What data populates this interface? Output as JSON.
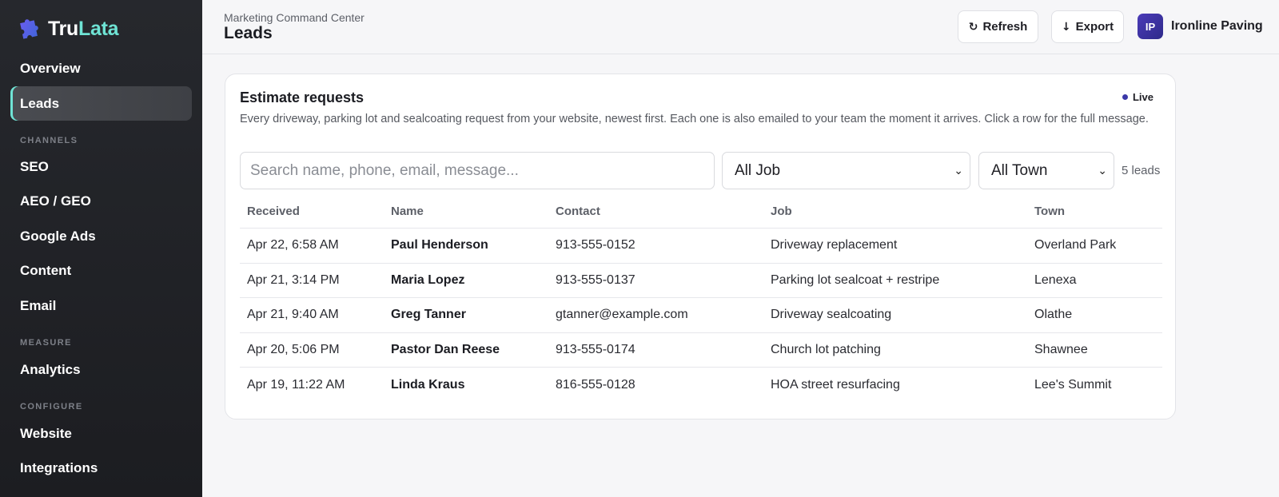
{
  "brand": {
    "part1": "Tru",
    "part2": "Lata",
    "accent_color": "#6fe3d4",
    "logo_icon": "puzzle-logo-icon"
  },
  "sidebar": {
    "items": [
      {
        "label": "Overview"
      },
      {
        "label": "Leads",
        "active": true
      },
      {
        "label": "SEO"
      },
      {
        "label": "AEO / GEO"
      },
      {
        "label": "Google Ads"
      },
      {
        "label": "Content"
      },
      {
        "label": "Email"
      },
      {
        "label": "Analytics"
      },
      {
        "label": "Website"
      },
      {
        "label": "Integrations"
      }
    ],
    "sections": {
      "channels": "CHANNELS",
      "measure": "MEASURE",
      "configure": "CONFIGURE"
    }
  },
  "header": {
    "breadcrumb": "Marketing Command Center",
    "title": "Leads",
    "refresh_label": "Refresh",
    "refresh_icon": "↻",
    "export_label": "Export",
    "export_icon": "↓",
    "avatar_initials": "IP",
    "account_name": "Ironline Paving"
  },
  "card": {
    "title": "Estimate requests",
    "live_label": "Live",
    "description": "Every driveway, parking lot and sealcoating request from your website, newest first. Each one is also emailed to your team the moment it arrives. Click a row for the full message.",
    "search_placeholder": "Search name, phone, email, message...",
    "job_filter": "All Job",
    "town_filter": "All Town",
    "lead_count": "5 leads"
  },
  "table": {
    "columns": [
      "Received",
      "Name",
      "Contact",
      "Job",
      "Town"
    ],
    "rows": [
      {
        "received": "Apr 22, 6:58 AM",
        "name": "Paul Henderson",
        "contact": "913-555-0152",
        "job": "Driveway replacement",
        "town": "Overland Park"
      },
      {
        "received": "Apr 21, 3:14 PM",
        "name": "Maria Lopez",
        "contact": "913-555-0137",
        "job": "Parking lot sealcoat + restripe",
        "town": "Lenexa"
      },
      {
        "received": "Apr 21, 9:40 AM",
        "name": "Greg Tanner",
        "contact": "gtanner@example.com",
        "job": "Driveway sealcoating",
        "town": "Olathe"
      },
      {
        "received": "Apr 20, 5:06 PM",
        "name": "Pastor Dan Reese",
        "contact": "913-555-0174",
        "job": "Church lot patching",
        "town": "Shawnee"
      },
      {
        "received": "Apr 19, 11:22 AM",
        "name": "Linda Kraus",
        "contact": "816-555-0128",
        "job": "HOA street resurfacing",
        "town": "Lee's Summit"
      }
    ]
  }
}
